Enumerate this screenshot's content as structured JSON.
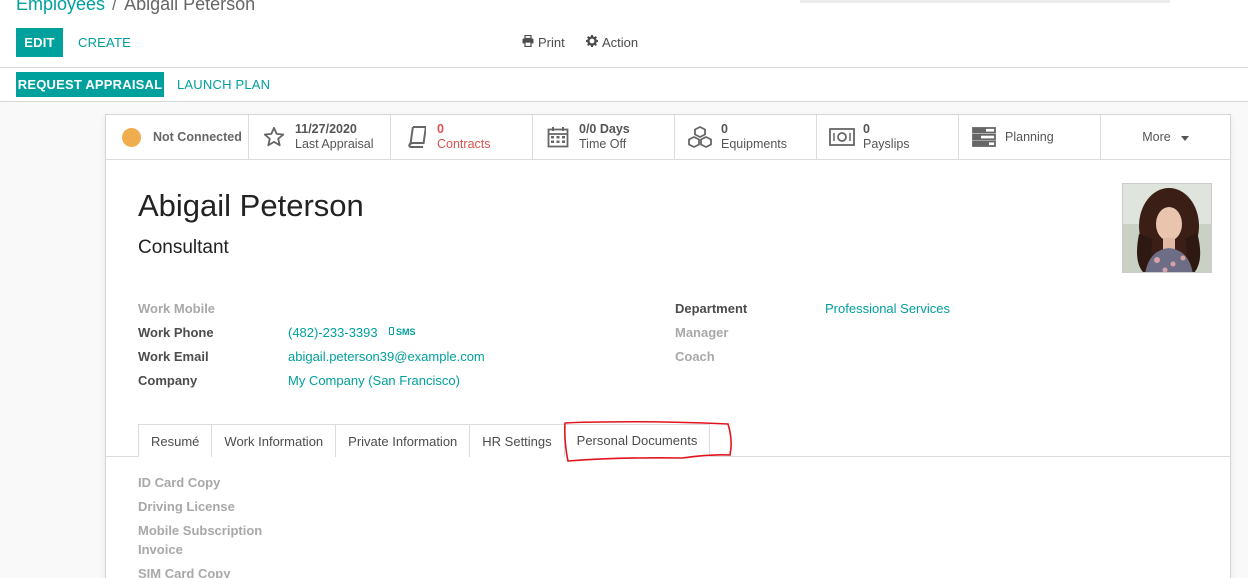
{
  "breadcrumb": {
    "parent": "Employees",
    "separator": "/",
    "current": "Abigail Peterson"
  },
  "control": {
    "edit_label": "EDIT",
    "create_label": "CREATE",
    "print_label": "Print",
    "action_label": "Action"
  },
  "statusbar": {
    "request_appraisal_label": "REQUEST APPRAISAL",
    "launch_plan_label": "LAUNCH PLAN"
  },
  "stats": {
    "presence": {
      "label": "Not Connected",
      "color": "#f0ad4e",
      "icon": "presence-dot"
    },
    "appraisal": {
      "value": "11/27/2020",
      "label": "Last Appraisal",
      "icon": "star-icon"
    },
    "contracts": {
      "value": "0",
      "label": "Contracts",
      "icon": "book-icon",
      "color": "#d9534f"
    },
    "timeoff": {
      "value": "0/0 Days",
      "label": "Time Off",
      "icon": "calendar-icon"
    },
    "equipments": {
      "value": "0",
      "label": "Equipments",
      "icon": "cubes-icon"
    },
    "payslips": {
      "value": "0",
      "label": "Payslips",
      "icon": "money-icon"
    },
    "planning": {
      "label": "Planning",
      "icon": "tasks-icon"
    },
    "more": {
      "label": "More",
      "icon": "caret-down-icon"
    }
  },
  "employee": {
    "name": "Abigail Peterson",
    "job_title": "Consultant"
  },
  "fields": {
    "work_mobile": {
      "label": "Work Mobile",
      "value": ""
    },
    "work_phone": {
      "label": "Work Phone",
      "value": "(482)-233-3393",
      "sms_label": "SMS"
    },
    "work_email": {
      "label": "Work Email",
      "value": "abigail.peterson39@example.com"
    },
    "company": {
      "label": "Company",
      "value": "My Company (San Francisco)"
    },
    "department": {
      "label": "Department",
      "value": "Professional Services"
    },
    "manager": {
      "label": "Manager",
      "value": ""
    },
    "coach": {
      "label": "Coach",
      "value": ""
    }
  },
  "tabs": [
    {
      "label": "Resumé"
    },
    {
      "label": "Work Information"
    },
    {
      "label": "Private Information"
    },
    {
      "label": "HR Settings"
    },
    {
      "label": "Personal Documents",
      "active": true
    }
  ],
  "documents": {
    "id_card": "ID Card Copy",
    "driving_license": "Driving License",
    "mobile_invoice": "Mobile Subscription Invoice",
    "sim_card": "SIM Card Copy"
  },
  "colors": {
    "accent": "#00A09D",
    "danger": "#d9534f",
    "annotation": "#e0141c"
  }
}
